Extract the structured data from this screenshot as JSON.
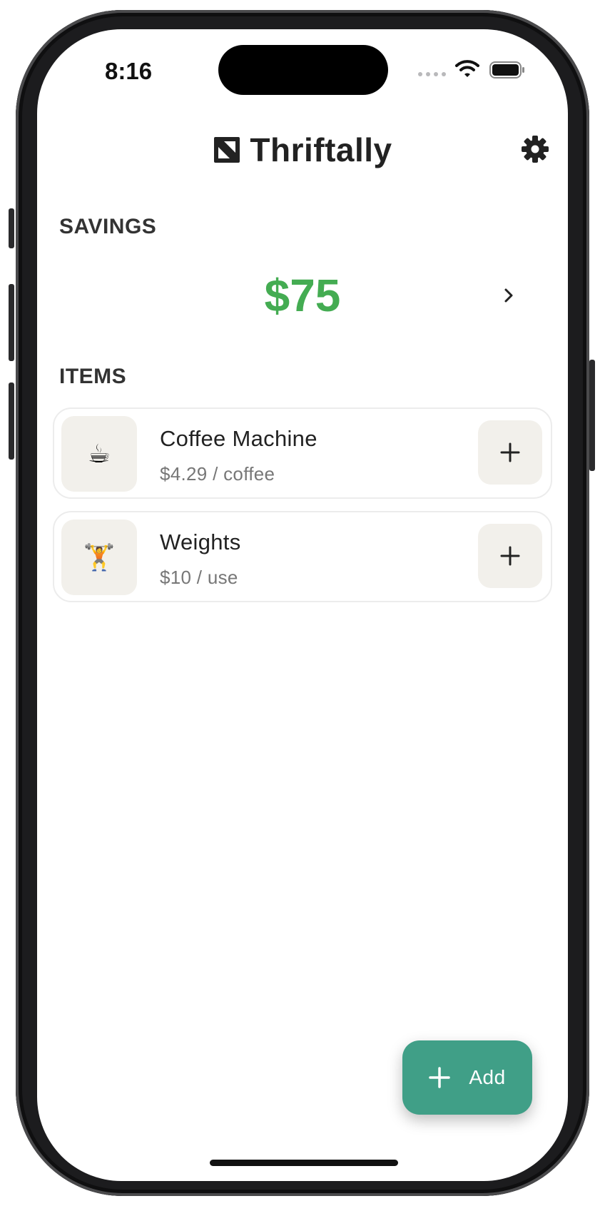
{
  "status_bar": {
    "time": "8:16"
  },
  "header": {
    "app_name": "Thriftally",
    "logo_icon": "app-logo-icon",
    "settings_icon": "gear-icon"
  },
  "savings": {
    "label": "SAVINGS",
    "amount": "$75",
    "amount_color": "#44ac52"
  },
  "items_section": {
    "label": "ITEMS",
    "items": [
      {
        "emoji": "☕",
        "name": "Coffee Machine",
        "price": "$4.29 / coffee"
      },
      {
        "emoji": "🏋️",
        "name": "Weights",
        "price": "$10 / use"
      }
    ]
  },
  "fab": {
    "label": "Add",
    "color": "#409f87"
  }
}
